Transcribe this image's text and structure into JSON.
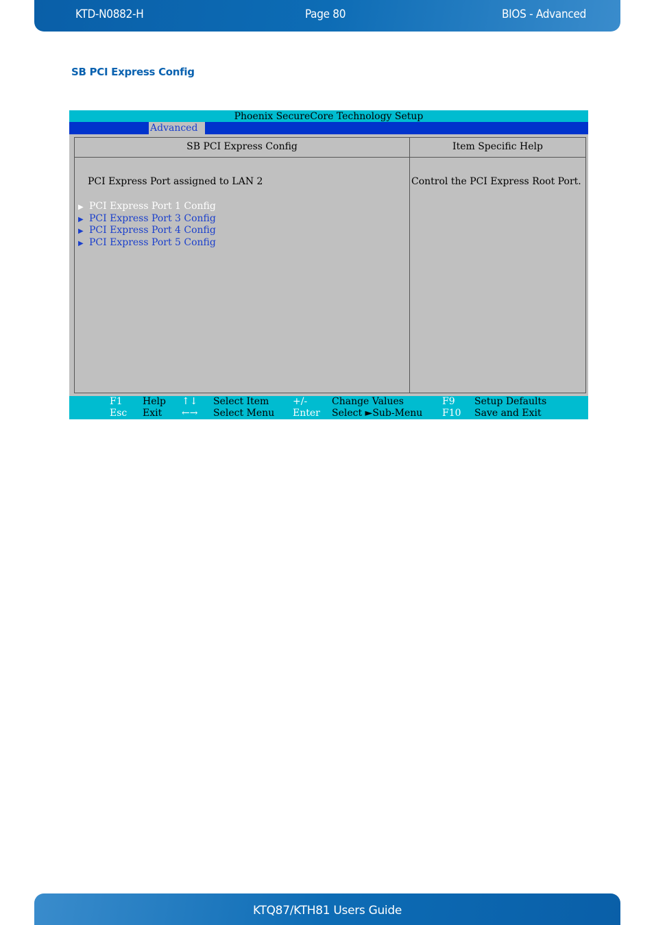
{
  "page_header": {
    "doc_id": "KTD-N0882-H",
    "page": "Page 80",
    "section": "BIOS  - Advanced"
  },
  "section_title": "SB PCI Express Config",
  "bios": {
    "title": "Phoenix SecureCore Technology Setup",
    "active_tab": "Advanced",
    "panel_title": "SB PCI Express Config",
    "help_title": "Item Specific Help",
    "setting_label": "PCI Express Port assigned to LAN 2",
    "submenus": [
      {
        "label": "PCI Express Port 1 Config",
        "selected": true,
        "icon": "right-triangle-icon"
      },
      {
        "label": "PCI Express Port 3 Config",
        "selected": false,
        "icon": "right-triangle-icon"
      },
      {
        "label": "PCI Express Port 4 Config",
        "selected": false,
        "icon": "right-triangle-icon"
      },
      {
        "label": "PCI Express Port 5 Config",
        "selected": false,
        "icon": "right-triangle-icon"
      }
    ],
    "help_text": "Control the PCI Express Root Port.",
    "footer": {
      "row1": [
        {
          "key": "F1",
          "desc": "Help"
        },
        {
          "key": "↑↓",
          "desc": "Select Item"
        },
        {
          "key": "+/-",
          "desc": "Change Values"
        },
        {
          "key": "F9",
          "desc": "Setup Defaults"
        }
      ],
      "row2": [
        {
          "key": "Esc",
          "desc": "Exit"
        },
        {
          "key": "←→",
          "desc": "Select Menu"
        },
        {
          "key": "Enter",
          "desc": "Select ►Sub-Menu"
        },
        {
          "key": "F10",
          "desc": "Save and Exit"
        }
      ]
    },
    "colors": {
      "title_bar": "#00bcd0",
      "menu_bar": "#0033cc",
      "panel": "#c0c0c0",
      "link": "#1a3fcc",
      "selected": "#ffffff"
    }
  },
  "page_footer": {
    "title": "KTQ87/KTH81 Users Guide"
  }
}
